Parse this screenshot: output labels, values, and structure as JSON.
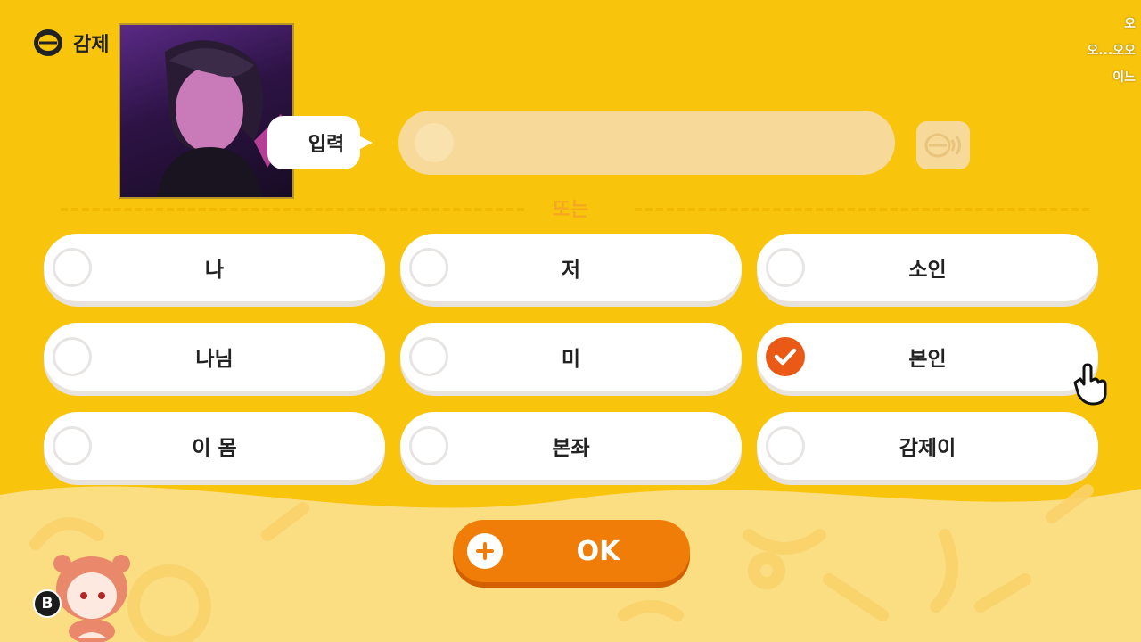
{
  "header": {
    "app_title": "감제"
  },
  "input": {
    "label": "입력",
    "placeholder": ""
  },
  "divider": {
    "or_label": "또는"
  },
  "options": [
    {
      "label": "나",
      "checked": false
    },
    {
      "label": "저",
      "checked": false
    },
    {
      "label": "소인",
      "checked": false
    },
    {
      "label": "나님",
      "checked": false
    },
    {
      "label": "미",
      "checked": false
    },
    {
      "label": "본인",
      "checked": true
    },
    {
      "label": "이 몸",
      "checked": false
    },
    {
      "label": "본좌",
      "checked": false
    },
    {
      "label": "감제이",
      "checked": false
    }
  ],
  "ok_button": {
    "label": "OK"
  },
  "b_button": {
    "label": "B"
  },
  "side_texts": [
    "오",
    "오...오오",
    "이느"
  ],
  "colors": {
    "background": "#f8c40c",
    "accent": "#f17d09",
    "checked": "#ea5a16"
  },
  "icons": {
    "logo": "lips-logo-icon",
    "voice": "voice-lips-icon",
    "ok": "plus-icon",
    "cursor": "hand-cursor-icon",
    "check": "check-icon"
  }
}
